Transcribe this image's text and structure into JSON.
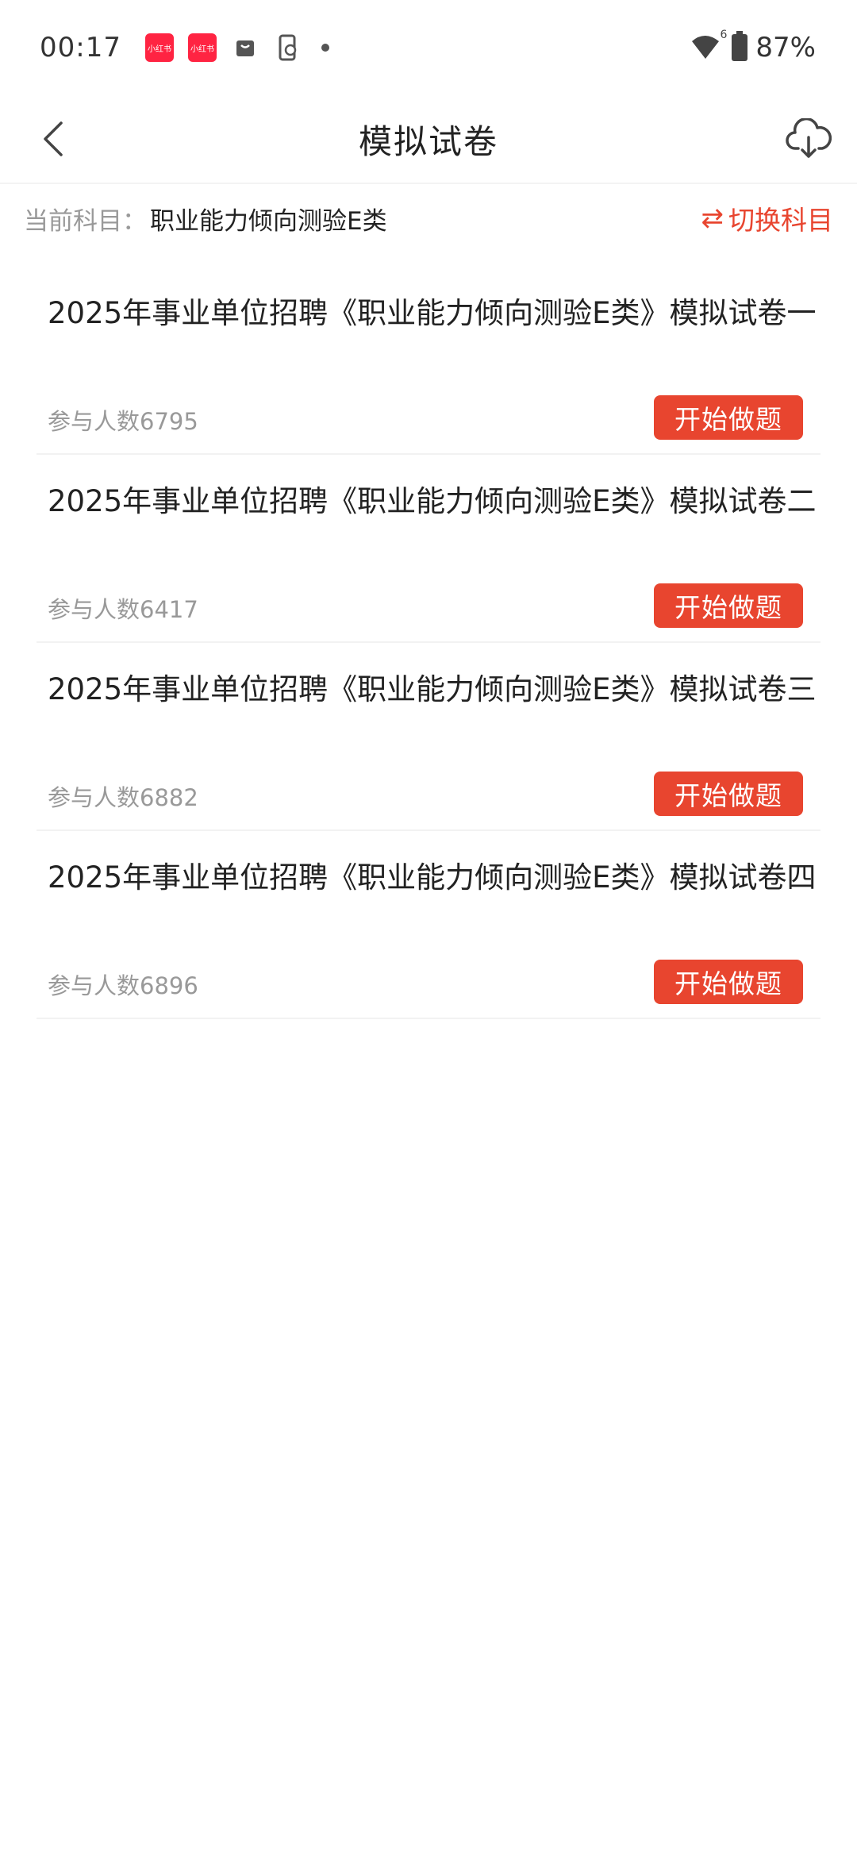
{
  "status_bar": {
    "time": "00:17",
    "app_badge_1": "小红书",
    "app_badge_2": "小红书",
    "battery": "87%",
    "wifi_label": "6"
  },
  "header": {
    "title": "模拟试卷"
  },
  "subject": {
    "label": "当前科目：",
    "value": "职业能力倾向测验E类",
    "switch_icon": "⇄",
    "switch_label": "切换科目"
  },
  "papers": [
    {
      "title": "2025年事业单位招聘《职业能力倾向测验E类》模拟试卷一",
      "participants": "参与人数6795",
      "button": "开始做题"
    },
    {
      "title": "2025年事业单位招聘《职业能力倾向测验E类》模拟试卷二",
      "participants": "参与人数6417",
      "button": "开始做题"
    },
    {
      "title": "2025年事业单位招聘《职业能力倾向测验E类》模拟试卷三",
      "participants": "参与人数6882",
      "button": "开始做题"
    },
    {
      "title": "2025年事业单位招聘《职业能力倾向测验E类》模拟试卷四",
      "participants": "参与人数6896",
      "button": "开始做题"
    }
  ],
  "colors": {
    "accent": "#e8452f",
    "badge": "#ff2442"
  }
}
